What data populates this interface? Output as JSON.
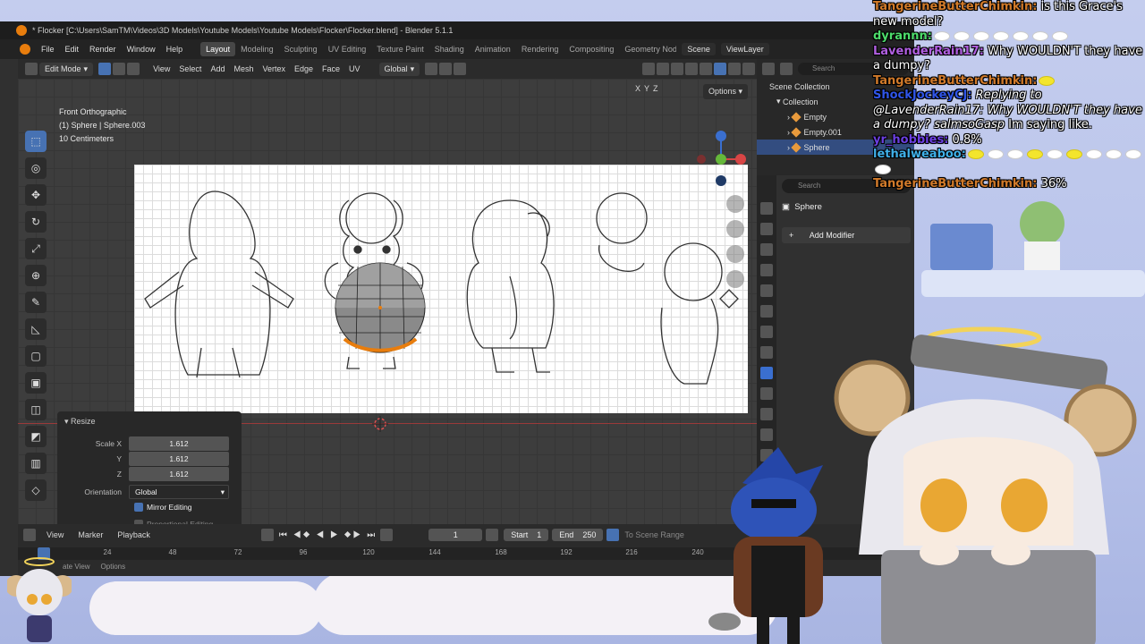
{
  "window": {
    "title": "* Flocker [C:\\Users\\SamTM\\Videos\\3D Models\\Youtube Models\\Youtube Models\\Flocker\\Flocker.blend] - Blender 5.1.1"
  },
  "menu": [
    "File",
    "Edit",
    "Render",
    "Window",
    "Help"
  ],
  "workspaces": [
    {
      "label": "Layout",
      "active": true
    },
    {
      "label": "Modeling"
    },
    {
      "label": "Sculpting"
    },
    {
      "label": "UV Editing"
    },
    {
      "label": "Texture Paint"
    },
    {
      "label": "Shading"
    },
    {
      "label": "Animation"
    },
    {
      "label": "Rendering"
    },
    {
      "label": "Compositing"
    },
    {
      "label": "Geometry Nodes"
    }
  ],
  "scene": {
    "label": "Scene",
    "view_layer": "ViewLayer"
  },
  "header3d": {
    "mode": "Edit Mode",
    "menus": [
      "View",
      "Select",
      "Add",
      "Mesh",
      "Vertex",
      "Edge",
      "Face",
      "UV"
    ],
    "transform_orientation": "Global"
  },
  "viewport": {
    "view_name": "Front Orthographic",
    "object_info": "(1) Sphere | Sphere.003",
    "scale_info": "10 Centimeters",
    "options_label": "Options",
    "axes": [
      "X",
      "Y",
      "Z"
    ]
  },
  "redo_panel": {
    "title": "Resize",
    "scale_x_label": "Scale X",
    "scale_y_label": "Y",
    "scale_z_label": "Z",
    "scale_x": "1.612",
    "scale_y": "1.612",
    "scale_z": "1.612",
    "orientation_label": "Orientation",
    "orientation": "Global",
    "mirror_editing": "Mirror Editing",
    "proportional_editing": "Proportional Editing"
  },
  "outliner": {
    "search_placeholder": "Search",
    "items": [
      "Scene Collection",
      "Collection",
      "Empty",
      "Empty.001",
      "Sphere"
    ]
  },
  "properties": {
    "search_placeholder": "Search",
    "object_name": "Sphere",
    "add_modifier": "Add Modifier"
  },
  "timeline": {
    "menus": [
      "View",
      "Marker",
      "Playback"
    ],
    "current_frame": "1",
    "start_label": "Start",
    "start": "1",
    "end_label": "End",
    "end": "250",
    "to_scene_range": "To Scene Range",
    "ticks": [
      "24",
      "48",
      "72",
      "96",
      "120",
      "144",
      "168",
      "192",
      "216",
      "240"
    ],
    "status_left": "ate View",
    "status_options": "Options"
  },
  "chat": [
    {
      "user": "TangerineButterChimkin:",
      "user_color": "#d17a2a",
      "text": "is this Grace's new model?"
    },
    {
      "user": "dyrannn:",
      "user_color": "#4ddc6b",
      "text": "",
      "emotes": [
        "white",
        "white",
        "white",
        "white",
        "white",
        "white",
        "white"
      ]
    },
    {
      "user": "LavenderRain17:",
      "user_color": "#b05fe0",
      "text": "Why WOULDN'T they have a dumpy?"
    },
    {
      "user": "TangerineButterChimkin:",
      "user_color": "#d17a2a",
      "text": "",
      "emotes": [
        "yellow"
      ]
    },
    {
      "user": "ShockJockeyCJ:",
      "user_color": "#2f55e8",
      "reply": "Replying to @LavenderRain17: Why WOULDN'T they have a dumpy? salmsoGasp",
      "text": "Im saying like."
    },
    {
      "user": "yr_hobbies:",
      "user_color": "#6b3fe0",
      "text": "0.8%"
    },
    {
      "user": "lethalweaboo:",
      "user_color": "#3fb0e8",
      "text": "",
      "emotes": [
        "yellow",
        "white",
        "white",
        "yellow",
        "white",
        "yellow",
        "white",
        "white",
        "white",
        "white"
      ]
    },
    {
      "user": "TangerineButterChimkin:",
      "user_color": "#d17a2a",
      "text": "36%"
    }
  ],
  "colors": {
    "blender_bg": "#303030",
    "accent_blue": "#4772b3",
    "selection_orange": "#e87d0d"
  }
}
